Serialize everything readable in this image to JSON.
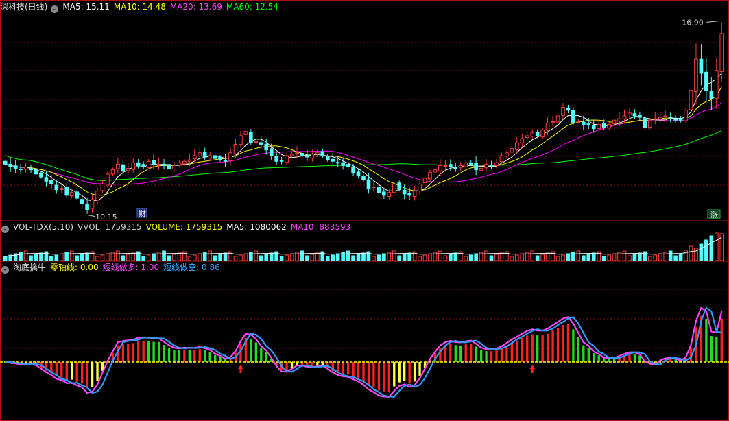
{
  "window": {
    "title": "深科技(日线)"
  },
  "main_panel": {
    "indicators": [
      {
        "label": "MA5: 15.11",
        "color": "#ffffff"
      },
      {
        "label": "MA10: 14.48",
        "color": "#ffff00"
      },
      {
        "label": "MA20: 13.69",
        "color": "#ff00ff"
      },
      {
        "label": "MA60: 12.54",
        "color": "#00ff00"
      }
    ],
    "high_label": "16.90",
    "low_label": "10.15",
    "event_badges": {
      "finance": "财",
      "limit_up": "涨"
    }
  },
  "volume_panel": {
    "title": "VOL-TDX(5,10)",
    "indicators": [
      {
        "label": "VVOL: 1759315",
        "color": "#cccccc"
      },
      {
        "label": "VOLUME: 1759315",
        "color": "#ffff00"
      },
      {
        "label": "MA5: 1080062",
        "color": "#ffffff"
      },
      {
        "label": "MA10: 883593",
        "color": "#ff00ff"
      }
    ]
  },
  "osc_panel": {
    "title": "淘底擒牛",
    "indicators": [
      {
        "label": "零轴线: 0.00",
        "color": "#ffff00"
      },
      {
        "label": "短线做多: 1.00",
        "color": "#ff44ff"
      },
      {
        "label": "短线做空: 0.86",
        "color": "#33aaff"
      }
    ]
  },
  "colors": {
    "up": "#ff3c3c",
    "down": "#54ffff",
    "grid": "#8a1010",
    "ma5": "#ffffff",
    "ma10": "#ffff00",
    "ma20": "#ff00ff",
    "ma60": "#00ff00",
    "osc_long": "#ff44ff",
    "osc_short": "#3399ff"
  },
  "chart_data": {
    "type": "candlestick",
    "closes": [
      11.9,
      11.8,
      11.75,
      11.7,
      11.8,
      11.7,
      11.55,
      11.45,
      11.3,
      11.2,
      11.0,
      11.05,
      10.8,
      10.9,
      10.7,
      10.5,
      10.3,
      10.65,
      10.95,
      11.2,
      11.55,
      11.7,
      11.9,
      11.65,
      11.75,
      11.95,
      11.85,
      11.8,
      12.0,
      11.9,
      11.9,
      11.85,
      11.75,
      11.85,
      11.95,
      12.0,
      12.05,
      12.2,
      12.3,
      12.15,
      12.2,
      12.1,
      12.05,
      12.0,
      12.3,
      12.6,
      12.9,
      13.05,
      12.65,
      12.7,
      12.6,
      12.4,
      12.2,
      12.0,
      12.0,
      12.2,
      12.25,
      12.3,
      12.2,
      12.15,
      12.25,
      12.3,
      12.2,
      12.05,
      12.0,
      11.95,
      11.85,
      11.8,
      11.6,
      11.5,
      11.35,
      11.05,
      11.1,
      10.9,
      10.8,
      10.9,
      11.2,
      11.0,
      10.85,
      10.8,
      10.95,
      11.2,
      11.4,
      11.6,
      11.7,
      11.85,
      11.85,
      11.8,
      11.75,
      11.85,
      11.95,
      11.9,
      11.7,
      11.75,
      11.9,
      11.85,
      11.95,
      12.2,
      12.3,
      12.45,
      12.65,
      12.8,
      12.9,
      13.0,
      12.9,
      13.1,
      13.35,
      13.4,
      13.6,
      13.9,
      13.8,
      13.35,
      13.4,
      13.3,
      13.3,
      13.15,
      13.3,
      13.2,
      13.3,
      13.45,
      13.5,
      13.6,
      13.7,
      13.6,
      13.55,
      13.2,
      13.45,
      13.5,
      13.55,
      13.6,
      13.5,
      13.45,
      13.45,
      13.8,
      14.5,
      15.6,
      15.1,
      14.5,
      14.2,
      15.2,
      16.5
    ],
    "ma_values": {
      "ma5": 15.11,
      "ma10": 14.48,
      "ma20": 13.69,
      "ma60": 12.54
    },
    "high": 16.9,
    "low": 10.15,
    "ylim": [
      10.0,
      17.2
    ],
    "volume": {
      "last": 1759315,
      "ma5": 1080062,
      "ma10": 883593
    },
    "oscillator": {
      "zero_line": 0.0,
      "long_last": 1.0,
      "short_last": 0.86
    },
    "grid": true
  }
}
